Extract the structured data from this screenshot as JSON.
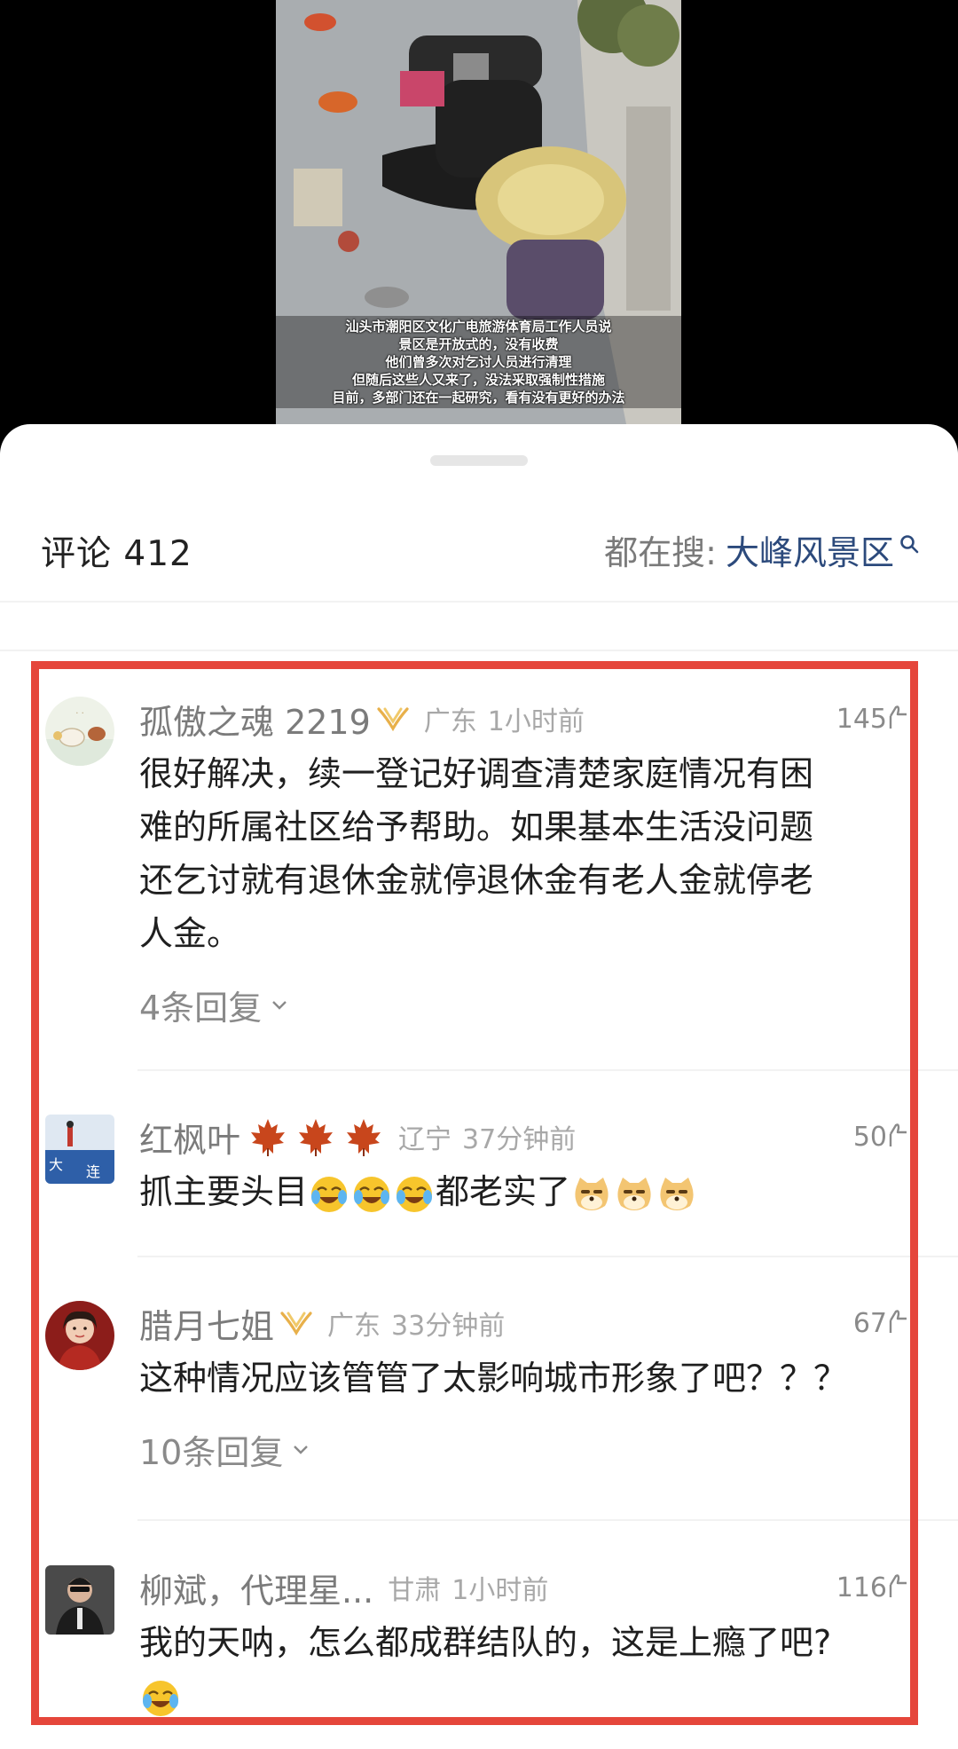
{
  "video": {
    "caption_lines": [
      "汕头市潮阳区文化广电旅游体育局工作人员说",
      "景区是开放式的，没有收费",
      "他们曾多次对乞讨人员进行清理",
      "但随后这些人又来了，没法采取强制性措施",
      "目前，多部门还在一起研究，看有没有更好的办法"
    ]
  },
  "header": {
    "title": "评论 412",
    "search_label": "都在搜:",
    "search_keyword": "大峰风景区",
    "keyword_color": "#2c4a7c"
  },
  "highlight_color": "#e5463b",
  "comments": [
    {
      "name": "孤傲之魂 2219",
      "badge": "vip-badge-icon",
      "location": "广东",
      "time": "1小时前",
      "likes": "145",
      "lines": [
        "很好解决，续一登记好调查清楚家庭情况有困",
        "难的所属社区给予帮助。如果基本生活没问题",
        "还乞讨就有退休金就停退休金有老人金就停老",
        "人金。"
      ],
      "replies": "4条回复"
    },
    {
      "name": "红枫叶",
      "icons": [
        "maple-leaf-icon",
        "maple-leaf-icon",
        "maple-leaf-icon"
      ],
      "location": "辽宁",
      "time": "37分钟前",
      "likes": "50",
      "text_a": "抓主要头目",
      "text_b": "都老实了",
      "emojis_a": [
        "crying-laugh-emoji",
        "crying-laugh-emoji",
        "crying-laugh-emoji"
      ],
      "emojis_b": [
        "doge-emoji",
        "doge-emoji",
        "doge-emoji"
      ]
    },
    {
      "name": "腊月七姐",
      "badge": "vip-badge-icon",
      "location": "广东",
      "time": "33分钟前",
      "likes": "67",
      "lines": [
        "这种情况应该管管了太影响城市形象了吧？？？"
      ],
      "replies": "10条回复"
    },
    {
      "name": "柳斌，代理星...",
      "location": "甘肃",
      "time": "1小时前",
      "likes": "116",
      "lines": [
        "我的天呐，怎么都成群结队的，这是上瘾了吧?"
      ],
      "trailing_emoji": "crying-laugh-emoji"
    }
  ]
}
